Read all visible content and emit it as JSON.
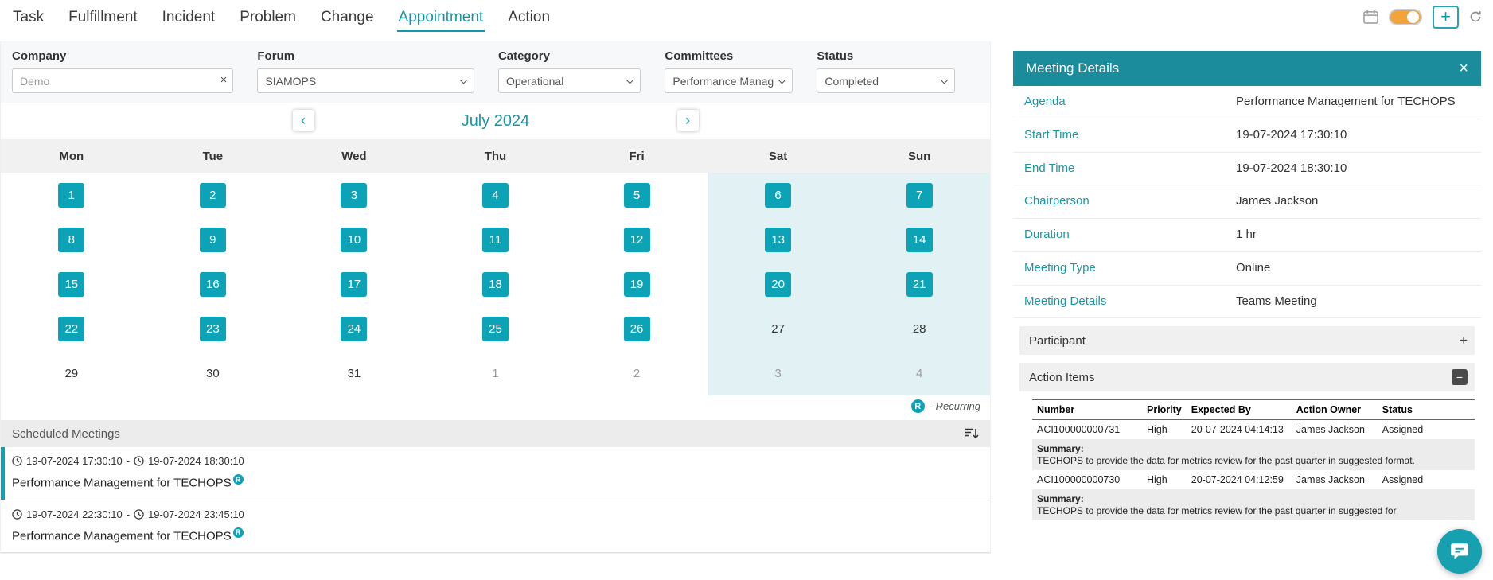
{
  "colors": {
    "accent": "#1697a8",
    "accent_bright": "#0da3b6",
    "panel_header": "#1b8c9c",
    "weekend_tint": "#e2f2f4",
    "bar_gray": "#ececec",
    "toggle_orange": "#f2a33a"
  },
  "nav": {
    "items": [
      {
        "label": "Task",
        "active": false
      },
      {
        "label": "Fulfillment",
        "active": false
      },
      {
        "label": "Incident",
        "active": false
      },
      {
        "label": "Problem",
        "active": false
      },
      {
        "label": "Change",
        "active": false
      },
      {
        "label": "Appointment",
        "active": true
      },
      {
        "label": "Action",
        "active": false
      }
    ]
  },
  "topbar": {
    "add_label": "+",
    "toggle_on": true
  },
  "filters": {
    "company": {
      "label": "Company",
      "value": "Demo",
      "clear": "×"
    },
    "forum": {
      "label": "Forum",
      "value": "SIAMOPS"
    },
    "category": {
      "label": "Category",
      "value": "Operational"
    },
    "committees": {
      "label": "Committees",
      "value": "Performance Manag"
    },
    "status": {
      "label": "Status",
      "value": "Completed"
    }
  },
  "calendar": {
    "month_label": "July 2024",
    "prev": "‹",
    "next": "›",
    "day_headers": [
      "Mon",
      "Tue",
      "Wed",
      "Thu",
      "Fri",
      "Sat",
      "Sun"
    ],
    "weeks": [
      [
        {
          "d": "1",
          "s": "box"
        },
        {
          "d": "2",
          "s": "box"
        },
        {
          "d": "3",
          "s": "box"
        },
        {
          "d": "4",
          "s": "box"
        },
        {
          "d": "5",
          "s": "box"
        },
        {
          "d": "6",
          "s": "box"
        },
        {
          "d": "7",
          "s": "box"
        }
      ],
      [
        {
          "d": "8",
          "s": "box"
        },
        {
          "d": "9",
          "s": "box"
        },
        {
          "d": "10",
          "s": "box"
        },
        {
          "d": "11",
          "s": "box"
        },
        {
          "d": "12",
          "s": "box"
        },
        {
          "d": "13",
          "s": "box"
        },
        {
          "d": "14",
          "s": "box"
        }
      ],
      [
        {
          "d": "15",
          "s": "box"
        },
        {
          "d": "16",
          "s": "box"
        },
        {
          "d": "17",
          "s": "box"
        },
        {
          "d": "18",
          "s": "box"
        },
        {
          "d": "19",
          "s": "box"
        },
        {
          "d": "20",
          "s": "box"
        },
        {
          "d": "21",
          "s": "box"
        }
      ],
      [
        {
          "d": "22",
          "s": "box"
        },
        {
          "d": "23",
          "s": "box"
        },
        {
          "d": "24",
          "s": "box"
        },
        {
          "d": "25",
          "s": "box"
        },
        {
          "d": "26",
          "s": "box"
        },
        {
          "d": "27",
          "s": "plain"
        },
        {
          "d": "28",
          "s": "plain"
        }
      ],
      [
        {
          "d": "29",
          "s": "plain"
        },
        {
          "d": "30",
          "s": "plain"
        },
        {
          "d": "31",
          "s": "plain"
        },
        {
          "d": "1",
          "s": "muted"
        },
        {
          "d": "2",
          "s": "muted"
        },
        {
          "d": "3",
          "s": "muted"
        },
        {
          "d": "4",
          "s": "muted"
        }
      ]
    ],
    "legend": {
      "symbol": "R",
      "text": "- Recurring"
    }
  },
  "scheduled_meetings": {
    "title": "Scheduled Meetings",
    "separator": "-",
    "items": [
      {
        "start": "19-07-2024 17:30:10",
        "end": "19-07-2024 18:30:10",
        "title": "Performance Management for TECHOPS",
        "recurring": true,
        "selected": true
      },
      {
        "start": "19-07-2024 22:30:10",
        "end": "19-07-2024 23:45:10",
        "title": "Performance Management for TECHOPS",
        "recurring": true,
        "selected": false
      }
    ]
  },
  "meeting_details": {
    "title": "Meeting Details",
    "close": "×",
    "fields": [
      {
        "label": "Agenda",
        "value": "Performance Management for TECHOPS"
      },
      {
        "label": "Start Time",
        "value": "19-07-2024 17:30:10"
      },
      {
        "label": "End Time",
        "value": "19-07-2024 18:30:10"
      },
      {
        "label": "Chairperson",
        "value": "James Jackson"
      },
      {
        "label": "Duration",
        "value": "1 hr"
      },
      {
        "label": "Meeting Type",
        "value": "Online"
      },
      {
        "label": "Meeting Details",
        "value": "Teams Meeting"
      }
    ],
    "participant": {
      "title": "Participant",
      "toggle": "+"
    },
    "action_items": {
      "title": "Action Items",
      "toggle": "−",
      "columns": [
        "Number",
        "Priority",
        "Expected By",
        "Action Owner",
        "Status"
      ],
      "rows": [
        {
          "number": "ACI100000000731",
          "priority": "High",
          "expected_by": "20-07-2024 04:14:13",
          "owner": "James Jackson",
          "status": "Assigned",
          "summary_label": "Summary:",
          "summary": "TECHOPS to provide the data for metrics review for the past quarter in suggested format."
        },
        {
          "number": "ACI100000000730",
          "priority": "High",
          "expected_by": "20-07-2024 04:12:59",
          "owner": "James Jackson",
          "status": "Assigned",
          "summary_label": "Summary:",
          "summary": "TECHOPS to provide the data for metrics review for the past quarter in suggested for"
        }
      ]
    }
  }
}
